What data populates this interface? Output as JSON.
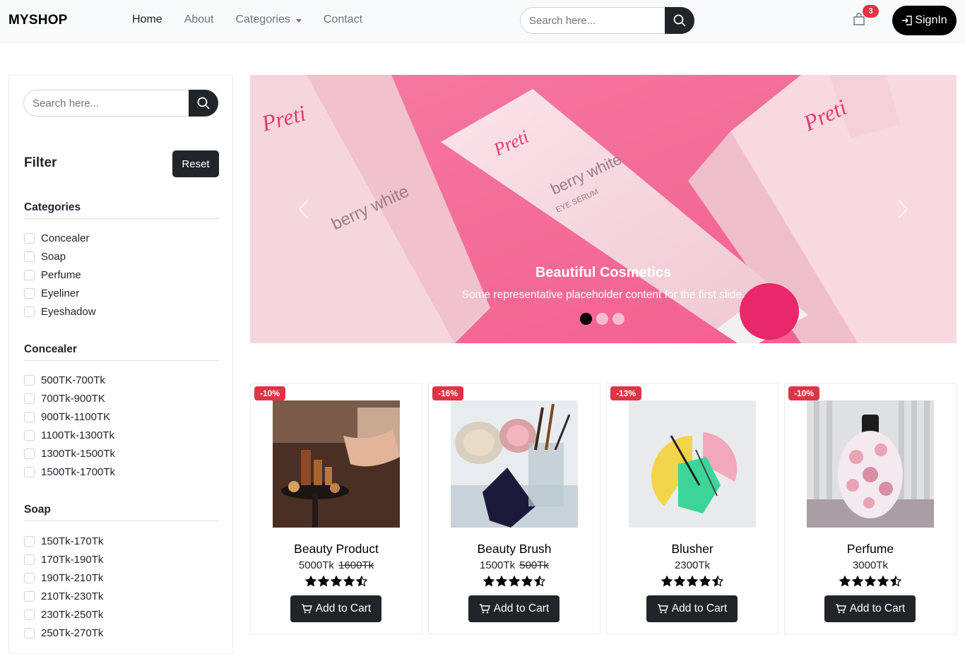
{
  "navbar": {
    "brand": "MYSHOP",
    "links": [
      {
        "label": "Home",
        "active": true
      },
      {
        "label": "About"
      },
      {
        "label": "Categories",
        "dropdown": true
      },
      {
        "label": "Contact"
      }
    ],
    "search_placeholder": "Search here...",
    "cart_count": "3",
    "signin_label": "SignIn"
  },
  "sidebar": {
    "search_placeholder": "Search here...",
    "filter_title": "Filter",
    "reset_label": "Reset",
    "groups": [
      {
        "title": "Categories",
        "items": [
          "Concealer",
          "Soap",
          "Perfume",
          "Eyeliner",
          "Eyeshadow"
        ]
      },
      {
        "title": "Concealer",
        "items": [
          "500TK-700Tk",
          "700Tk-900TK",
          "900Tk-1100TK",
          "1100Tk-1300Tk",
          "1300Tk-1500Tk",
          "1500Tk-1700Tk"
        ]
      },
      {
        "title": "Soap",
        "items": [
          "150Tk-170Tk",
          "170Tk-190Tk",
          "190Tk-210Tk",
          "210Tk-230Tk",
          "230Tk-250Tk",
          "250Tk-270Tk"
        ]
      }
    ]
  },
  "carousel": {
    "caption_title": "Beautiful Cosmetics",
    "caption_text": "Some representative placeholder content for the first slide.",
    "brand_text": "Preti",
    "product_text": "berry white",
    "product_subtext": "EYE SERUM",
    "slide_count": 3,
    "active_index": 0
  },
  "products": [
    {
      "name": "Beauty Product",
      "price": "5000Tk",
      "old_price": "1600Tk",
      "discount": "-10%",
      "rating": 4.5
    },
    {
      "name": "Beauty Brush",
      "price": "1500Tk",
      "old_price": "500Tk",
      "discount": "-16%",
      "rating": 4.5
    },
    {
      "name": "Blusher",
      "price": "2300Tk",
      "old_price": "",
      "discount": "-13%",
      "rating": 4.5
    },
    {
      "name": "Perfume",
      "price": "3000Tk",
      "old_price": "",
      "discount": "-10%",
      "rating": 4.5
    }
  ],
  "add_to_cart_label": "Add to Cart",
  "colors": {
    "dark": "#212529",
    "badge_red": "#dc3545",
    "carousel_pink": "#f47ba1",
    "navbar_bg": "#f8f9fa"
  }
}
